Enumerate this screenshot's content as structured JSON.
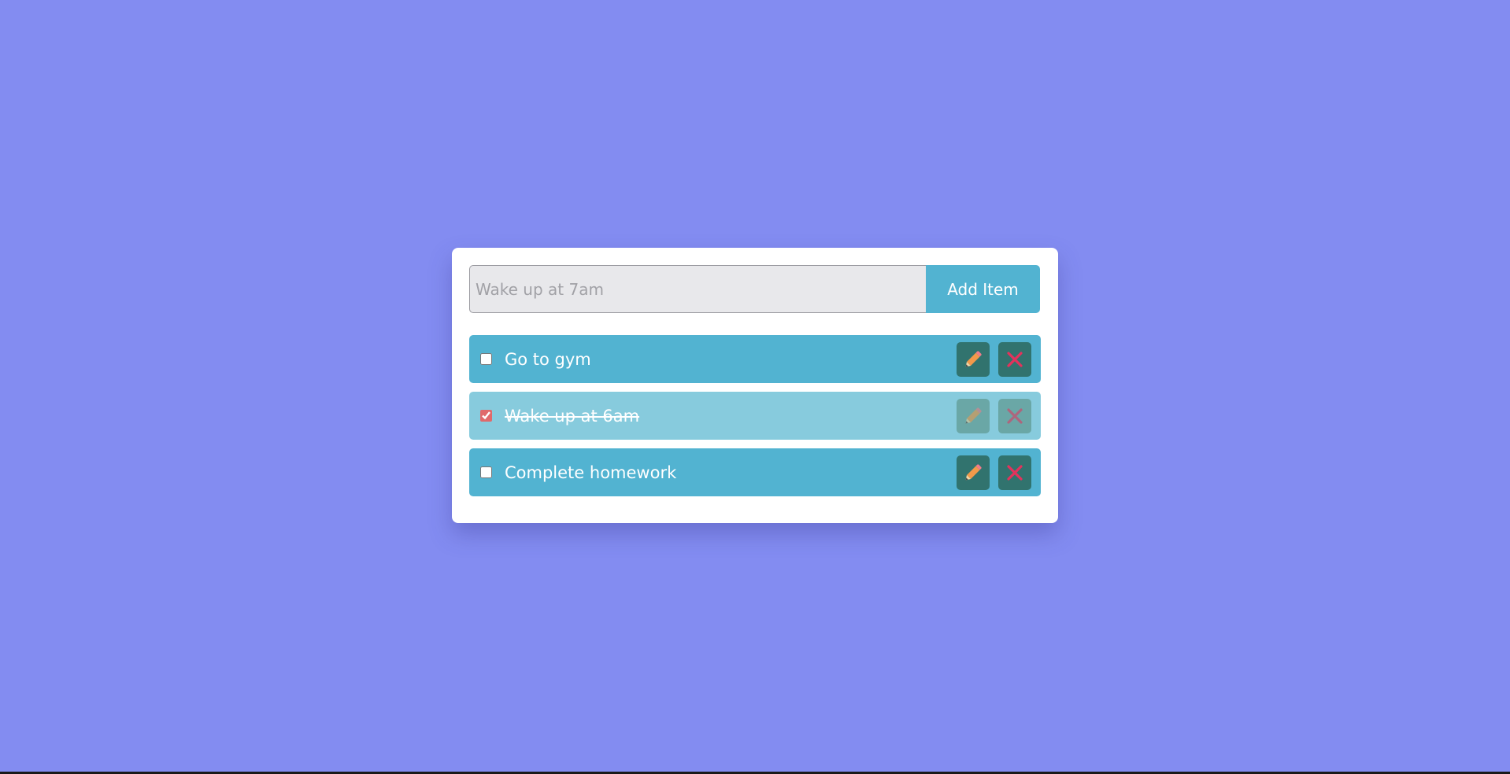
{
  "form": {
    "input_placeholder": "Wake up at 7am",
    "input_value": "",
    "add_button_label": "Add Item"
  },
  "todos": [
    {
      "text": "Go to gym",
      "completed": false,
      "edit_icon": "pencil-icon",
      "delete_icon": "close-icon"
    },
    {
      "text": "Wake up at 6am",
      "completed": true,
      "edit_icon": "pencil-icon",
      "delete_icon": "close-icon"
    },
    {
      "text": "Complete homework",
      "completed": false,
      "edit_icon": "pencil-icon",
      "delete_icon": "close-icon"
    }
  ],
  "colors": {
    "background": "#838cf1",
    "card": "#ffffff",
    "item": "#52b3d1",
    "item_done": "#87cbdd",
    "action_button": "#31736e",
    "delete_icon": "#e4325c",
    "edit_icon": "#f2994a"
  }
}
